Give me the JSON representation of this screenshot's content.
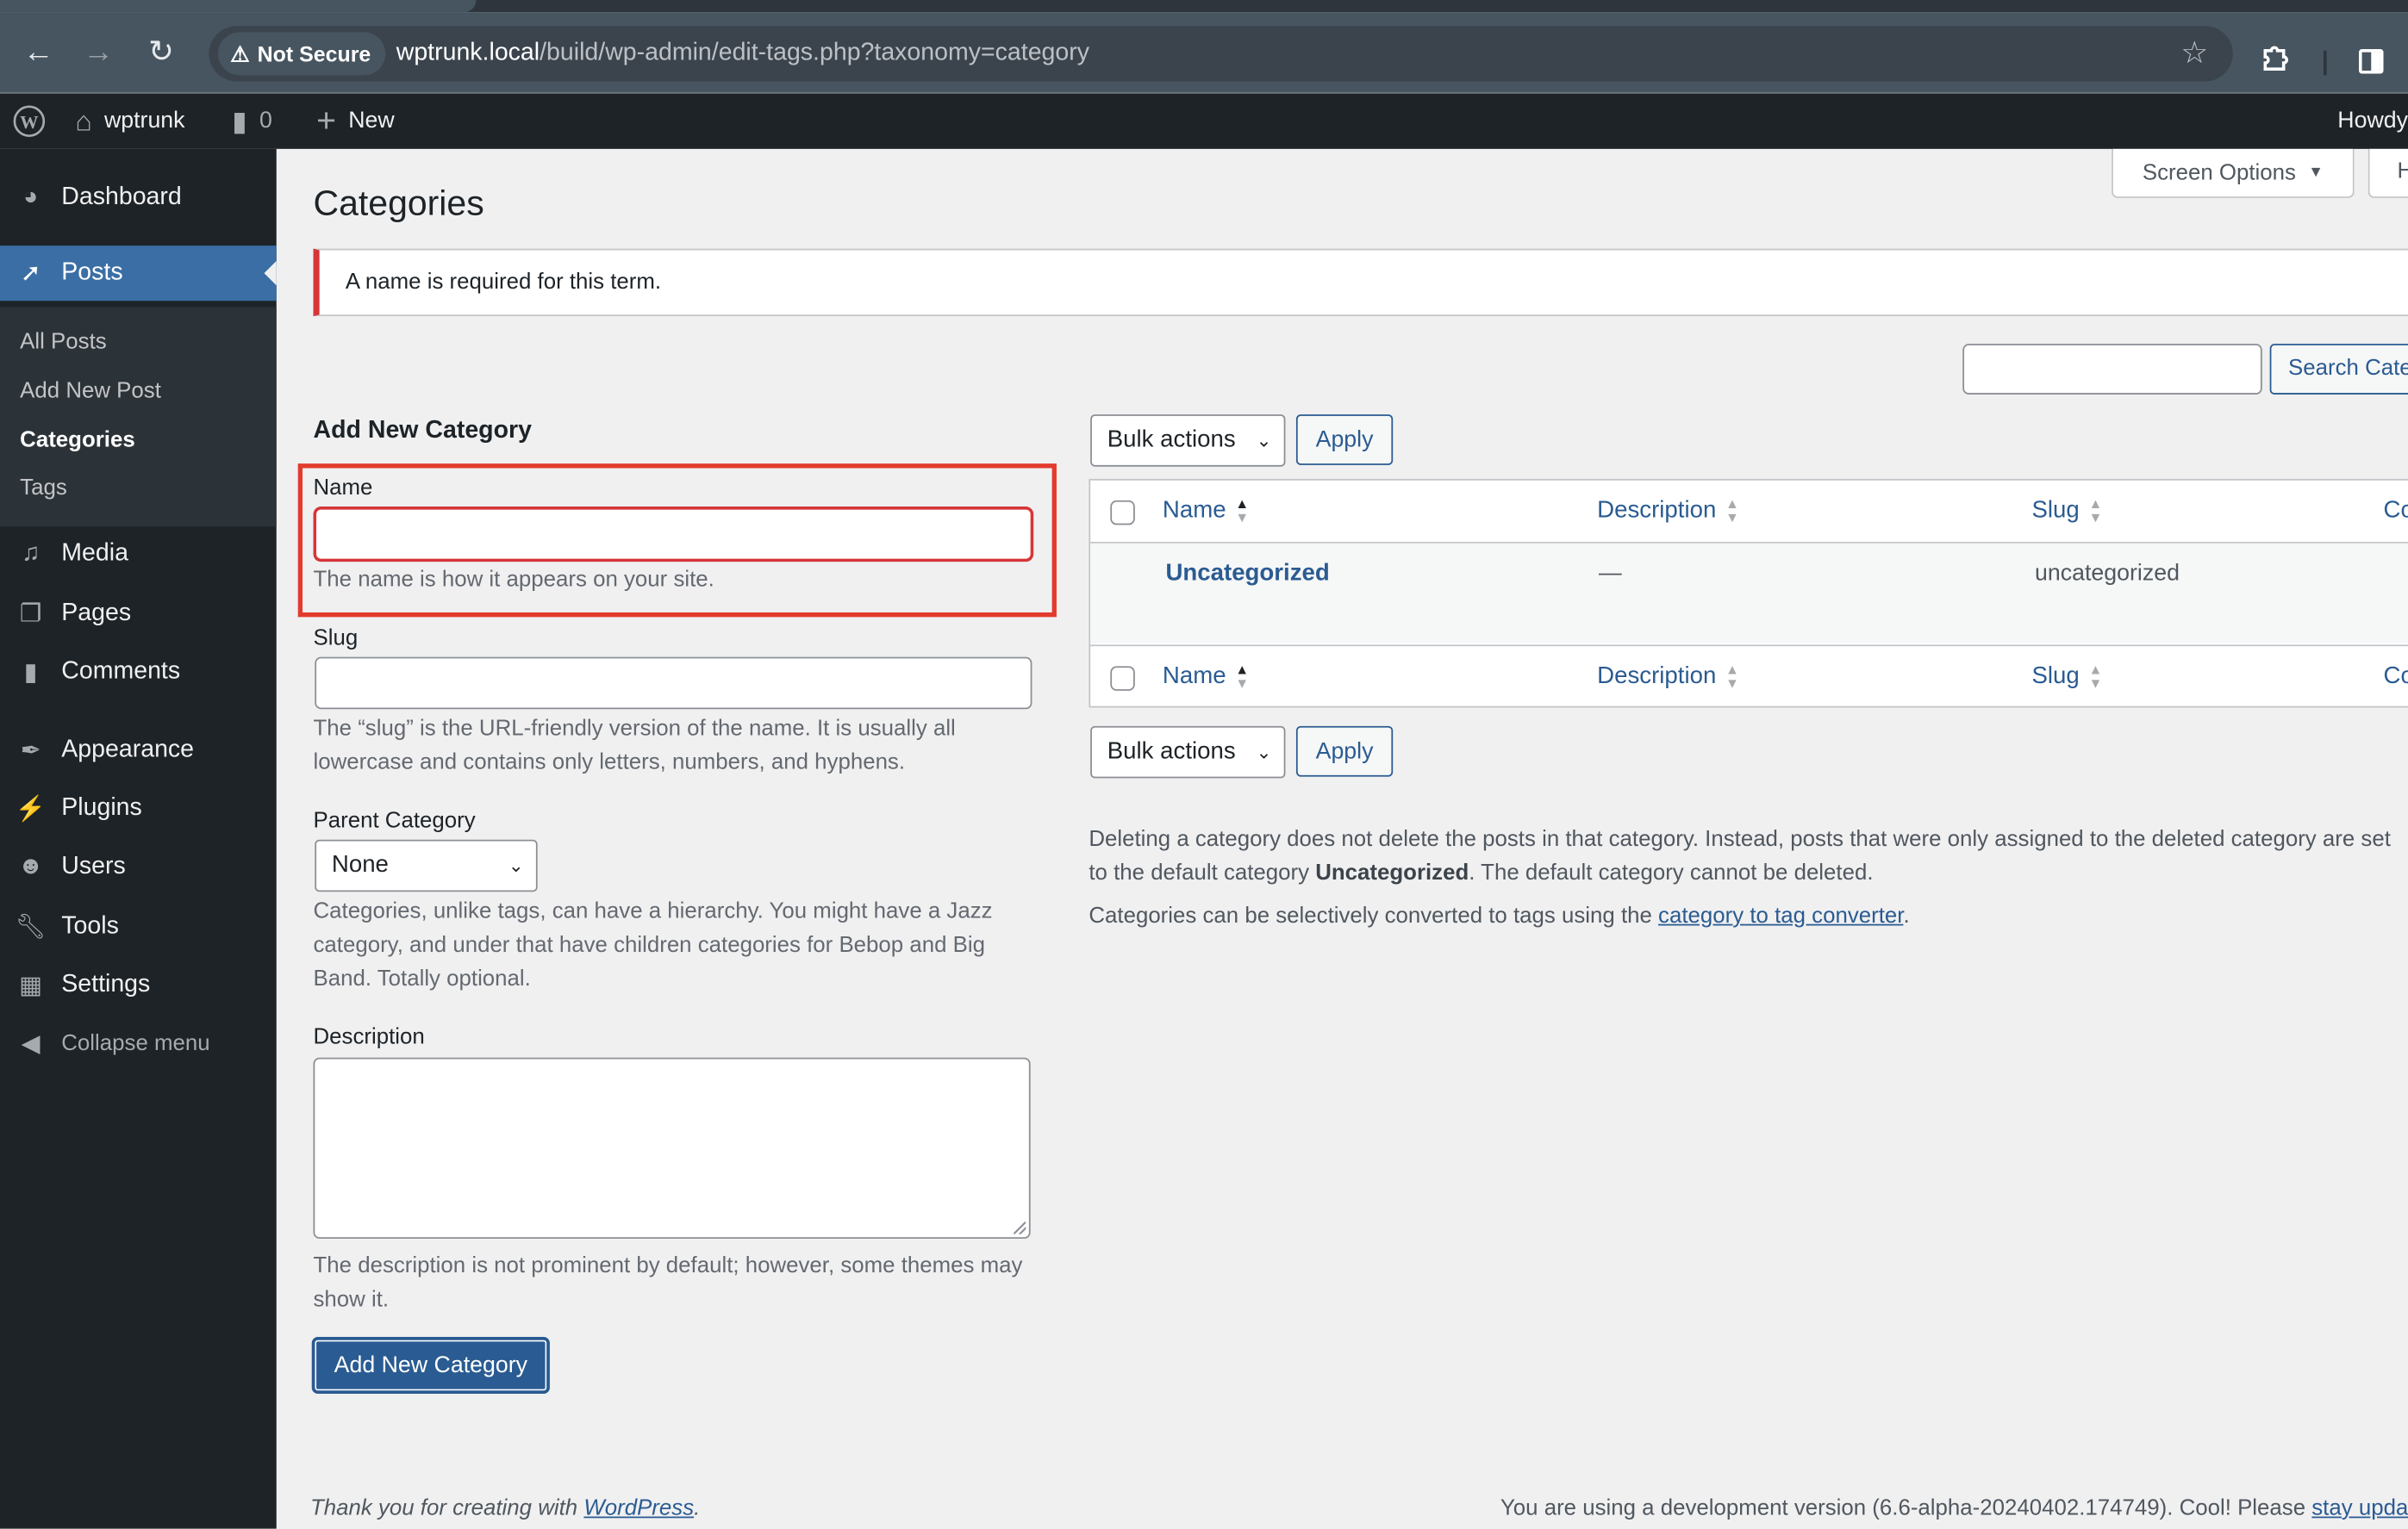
{
  "browser": {
    "security_label": "Not Secure",
    "url_host": "wptrunk.local",
    "url_path": "/build/wp-admin/edit-tags.php?taxonomy=category"
  },
  "adminbar": {
    "site_name": "wptrunk",
    "comment_count": "0",
    "new_label": "New",
    "howdy": "Howdy"
  },
  "sidebar": {
    "items": [
      {
        "label": "Dashboard",
        "icon": "dashboard-icon"
      },
      {
        "label": "Posts",
        "icon": "pin-icon",
        "active": true
      },
      {
        "label": "Media",
        "icon": "media-icon"
      },
      {
        "label": "Pages",
        "icon": "pages-icon"
      },
      {
        "label": "Comments",
        "icon": "comments-icon"
      },
      {
        "label": "Appearance",
        "icon": "brush-icon"
      },
      {
        "label": "Plugins",
        "icon": "plug-icon"
      },
      {
        "label": "Users",
        "icon": "user-icon"
      },
      {
        "label": "Tools",
        "icon": "wrench-icon"
      },
      {
        "label": "Settings",
        "icon": "settings-icon"
      }
    ],
    "submenu": [
      {
        "label": "All Posts"
      },
      {
        "label": "Add New Post"
      },
      {
        "label": "Categories",
        "current": true
      },
      {
        "label": "Tags"
      }
    ],
    "collapse_label": "Collapse menu"
  },
  "header": {
    "screen_options": "Screen Options",
    "help": "Help",
    "title": "Categories"
  },
  "notice": {
    "text": "A name is required for this term.",
    "color": "#d63638"
  },
  "form": {
    "title": "Add New Category",
    "name_label": "Name",
    "name_value": "",
    "name_help": "The name is how it appears on your site.",
    "slug_label": "Slug",
    "slug_value": "",
    "slug_help": "The “slug” is the URL-friendly version of the name. It is usually all lowercase and contains only letters, numbers, and hyphens.",
    "parent_label": "Parent Category",
    "parent_selected": "None",
    "parent_help": "Categories, unlike tags, can have a hierarchy. You might have a Jazz category, and under that have children categories for Bebop and Big Band. Totally optional.",
    "description_label": "Description",
    "description_value": "",
    "description_help": "The description is not prominent by default; however, some themes may show it.",
    "submit_label": "Add New Category"
  },
  "list": {
    "search_value": "",
    "search_button": "Search Categories",
    "bulk_actions": "Bulk actions",
    "apply_label": "Apply",
    "columns": [
      "Name",
      "Description",
      "Slug",
      "Count"
    ],
    "rows": [
      {
        "name": "Uncategorized",
        "description": "—",
        "slug": "uncategorized"
      }
    ],
    "note1_a": "Deleting a category does not delete the posts in that category. Instead, posts that were only assigned to the deleted category are set",
    "note1_b": "to the default category ",
    "note1_bold": "Uncategorized",
    "note1_c": ". The default category cannot be deleted.",
    "note2_a": "Categories can be selectively converted to tags using the ",
    "note2_link": "category to tag converter",
    "note2_c": "."
  },
  "footer": {
    "thanks_a": "Thank you for creating with ",
    "thanks_link": "WordPress",
    "thanks_c": ".",
    "version_text": "You are using a development version (6.6-alpha-20240402.174749). Cool! Please ",
    "version_link": "stay updated"
  },
  "colors": {
    "accent": "#2a5b92",
    "admin_bar": "#1d2327",
    "highlight_box": "#e23b2e"
  }
}
